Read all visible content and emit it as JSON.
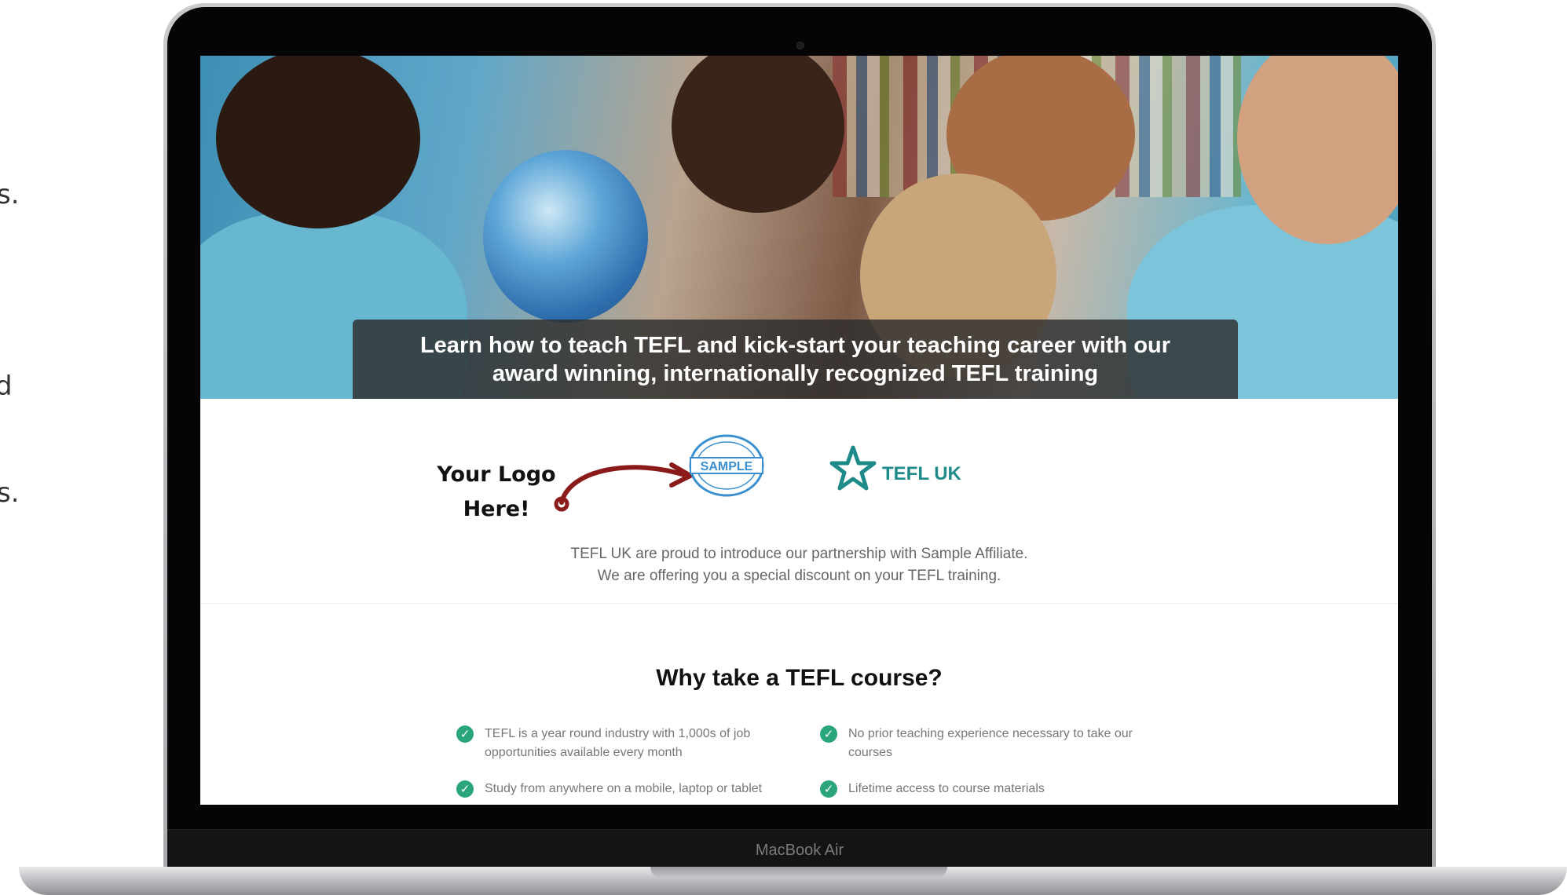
{
  "side_fragments": [
    "s.",
    "d",
    "s."
  ],
  "hero": {
    "caption": "Learn how to teach TEFL and kick-start your teaching career with our award winning, internationally recognized TEFL training"
  },
  "logo_section": {
    "placeholder_label_line1": "Your Logo",
    "placeholder_label_line2": "Here!",
    "sample_stamp_text": "SAMPLE",
    "partner_logo_text": "TEFL UK",
    "intro_line1": "TEFL UK are proud to introduce our partnership with Sample Affiliate.",
    "intro_line2": "We are offering you a special discount on your TEFL training."
  },
  "why": {
    "title": "Why take a TEFL course?",
    "benefits": [
      "TEFL is a year round industry with 1,000s of job opportunities available every month",
      "No prior teaching experience necessary to take our courses",
      "Study from anywhere on a mobile, laptop or tablet",
      "Lifetime access to course materials"
    ]
  },
  "device": {
    "label": "MacBook Air"
  },
  "colors": {
    "accent_green": "#2aa67a",
    "brand_teal": "#1e8a8a",
    "arrow_red": "#8b1a1a"
  }
}
